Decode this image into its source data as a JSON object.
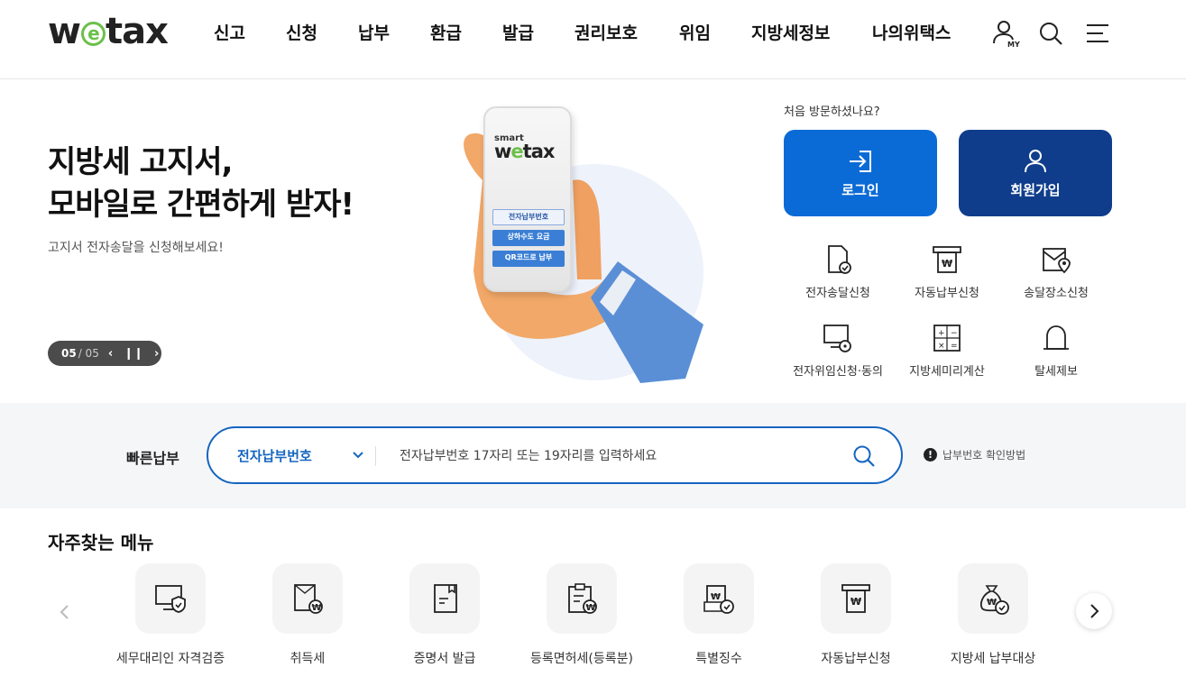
{
  "header": {
    "logo_pre": "w",
    "logo_e": "e",
    "logo_post": "tax",
    "nav": [
      "신고",
      "신청",
      "납부",
      "환급",
      "발급",
      "권리보호",
      "위임",
      "지방세정보",
      "나의위택스"
    ],
    "my_label": "MY",
    "icons": [
      "user-icon",
      "search-icon",
      "menu-icon"
    ]
  },
  "hero": {
    "title_line1": "지방세 고지서,",
    "title_line2": "모바일로 간편하게 받자!",
    "subtitle": "고지서 전자송달을 신청해보세요!",
    "pager_current": "05",
    "pager_total": "/ 05",
    "phone": {
      "brand_small": "smart",
      "brand_pre": "w",
      "brand_e": "e",
      "brand_post": "tax",
      "buttons": [
        "전자납부번호",
        "상하수도 요금",
        "QR코드로 납부"
      ]
    }
  },
  "account": {
    "visit_text": "처음 방문하셨나요?",
    "login_label": "로그인",
    "join_label": "회원가입"
  },
  "quick_menu": [
    {
      "label": "전자송달신청",
      "icon": "document-check-icon"
    },
    {
      "label": "자동납부신청",
      "icon": "auto-pay-icon"
    },
    {
      "label": "송달장소신청",
      "icon": "mail-location-icon"
    },
    {
      "label": "전자위임신청·동의",
      "icon": "monitor-lock-icon"
    },
    {
      "label": "지방세미리계산",
      "icon": "calculator-icon"
    },
    {
      "label": "탈세제보",
      "icon": "alarm-bell-icon"
    }
  ],
  "fast_pay": {
    "label": "빠른납부",
    "select_value": "전자납부번호",
    "input_placeholder": "전자납부번호 17자리 또는 19자리를 입력하세요",
    "help_text": "납부번호 확인방법",
    "help_mark": "!"
  },
  "frequent": {
    "title": "자주찾는 메뉴",
    "items": [
      {
        "label": "세무대리인 자격검증",
        "icon": "monitor-shield-icon"
      },
      {
        "label": "취득세",
        "icon": "acquisition-tax-icon"
      },
      {
        "label": "증명서 발급",
        "icon": "certificate-icon"
      },
      {
        "label": "등록면허세(등록분)",
        "icon": "registration-tax-icon"
      },
      {
        "label": "특별징수",
        "icon": "special-collection-icon"
      },
      {
        "label": "자동납부신청",
        "icon": "auto-pay-icon"
      },
      {
        "label": "지방세 납부대상",
        "icon": "money-bag-icon"
      }
    ]
  },
  "colors": {
    "primary": "#0b6bd6",
    "dark_primary": "#0f3d8c",
    "logo_green": "#6cc04a",
    "search_border": "#1565c0"
  }
}
